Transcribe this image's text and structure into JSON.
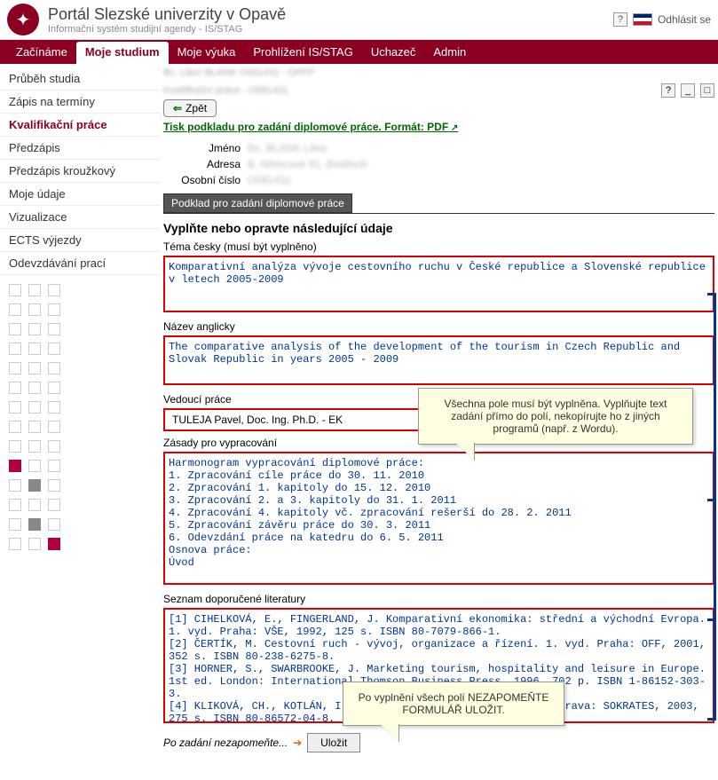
{
  "header": {
    "title": "Portál Slezské univerzity v Opavě",
    "subtitle": "Informační systém studijní agendy - IS/STAG",
    "logout": "Odhlásit se",
    "help": "?"
  },
  "nav": {
    "items": [
      "Začínáme",
      "Moje studium",
      "Moje výuka",
      "Prohlížení IS/STAG",
      "Uchazeč",
      "Admin"
    ],
    "active": 1
  },
  "sidebar": {
    "items": [
      "Průběh studia",
      "Zápis na termíny",
      "Kvalifikační práce",
      "Předzápis",
      "Předzápis kroužkový",
      "Moje údaje",
      "Vizualizace",
      "ECTS výjezdy",
      "Odevzdávání prací"
    ],
    "current": 2
  },
  "breadcrumb1": "Bc. Libor BLANK   O081431 - OPFP",
  "breadcrumb2": "Kvalifikační práce - O081431",
  "win": {
    "help": "?",
    "min": "_",
    "close": "□"
  },
  "back": "Zpět",
  "pdf_link": "Tisk podkladu pro zadání diplomové práce. Formát: PDF",
  "info": {
    "name_label": "Jméno",
    "name_value": "Bc. BLANK Libor",
    "addr_label": "Adresa",
    "addr_value": "B. Němcové 81, Bediheší",
    "num_label": "Osobní číslo",
    "num_value": "O081431"
  },
  "section_header": "Podklad pro zadání diplomové práce",
  "form": {
    "title": "Vyplňte nebo opravte následující údaje",
    "topic_cs_label": "Téma česky (musí být vyplněno)",
    "topic_cs": "Komparativní analýza vývoje cestovního ruchu v České republice a Slovenské republice v letech 2005-2009",
    "title_en_label": "Název anglicky",
    "title_en": "The comparative analysis of the development of the tourism in Czech Republic and Slovak Republic in years 2005 - 2009",
    "supervisor_label": "Vedoucí práce",
    "supervisor": "TULEJA Pavel, Doc. Ing. Ph.D. - EK",
    "principles_label": "Zásady pro vypracování",
    "principles": "Harmonogram vypracování diplomové práce:\n1. Zpracování cíle práce do 30. 11. 2010\n2. Zpracování 1. kapitoly do 15. 12. 2010\n3. Zpracování 2. a 3. kapitoly do 31. 1. 2011\n4. Zpracování 4. kapitoly vč. zpracování rešerší do 28. 2. 2011\n5. Zpracování závěru práce do 30. 3. 2011\n6. Odevzdání práce na katedru do 6. 5. 2011\nOsnova práce:\nÚvod",
    "literature_label": "Seznam doporučené literatury",
    "literature": "[1] CIHELKOVÁ, E., FINGERLAND, J. Komparativní ekonomika: střední a východní Evropa. 1. vyd. Praha: VŠE, 1992, 125 s. ISBN 80-7079-866-1.\n[2] ČERTÍK, M. Cestovní ruch - vývoj, organizace a řízení. 1. vyd. Praha: OFF, 2001, 352 s. ISBN 80-238-6275-8.\n[3] HORNER, S., SWARBROOKE, J. Marketing tourism, hospitality and leisure in Europe. 1st ed. London: International Thomson Business Press, 1996, 702 p. ISBN 1-86152-303-3.\n[4] KLIKOVÁ, CH., KOTLÁN, I. Hospodářská politika. 1. vyd. Ostrava: SOKRATES, 2003, 275 s. ISBN 80-86572-04-8.",
    "save_prompt": "Po zadání nezapomeňte...",
    "save_btn": "Uložit"
  },
  "callouts": {
    "fill": "Všechna pole musí být vyplněna. Vyplňujte text zadání přímo do polí, nekopírujte ho z jiných programů (např. z Wordu).",
    "save": "Po vyplnění všech polí NEZAPOMEŇTE FORMULÁŘ ULOŽIT."
  }
}
